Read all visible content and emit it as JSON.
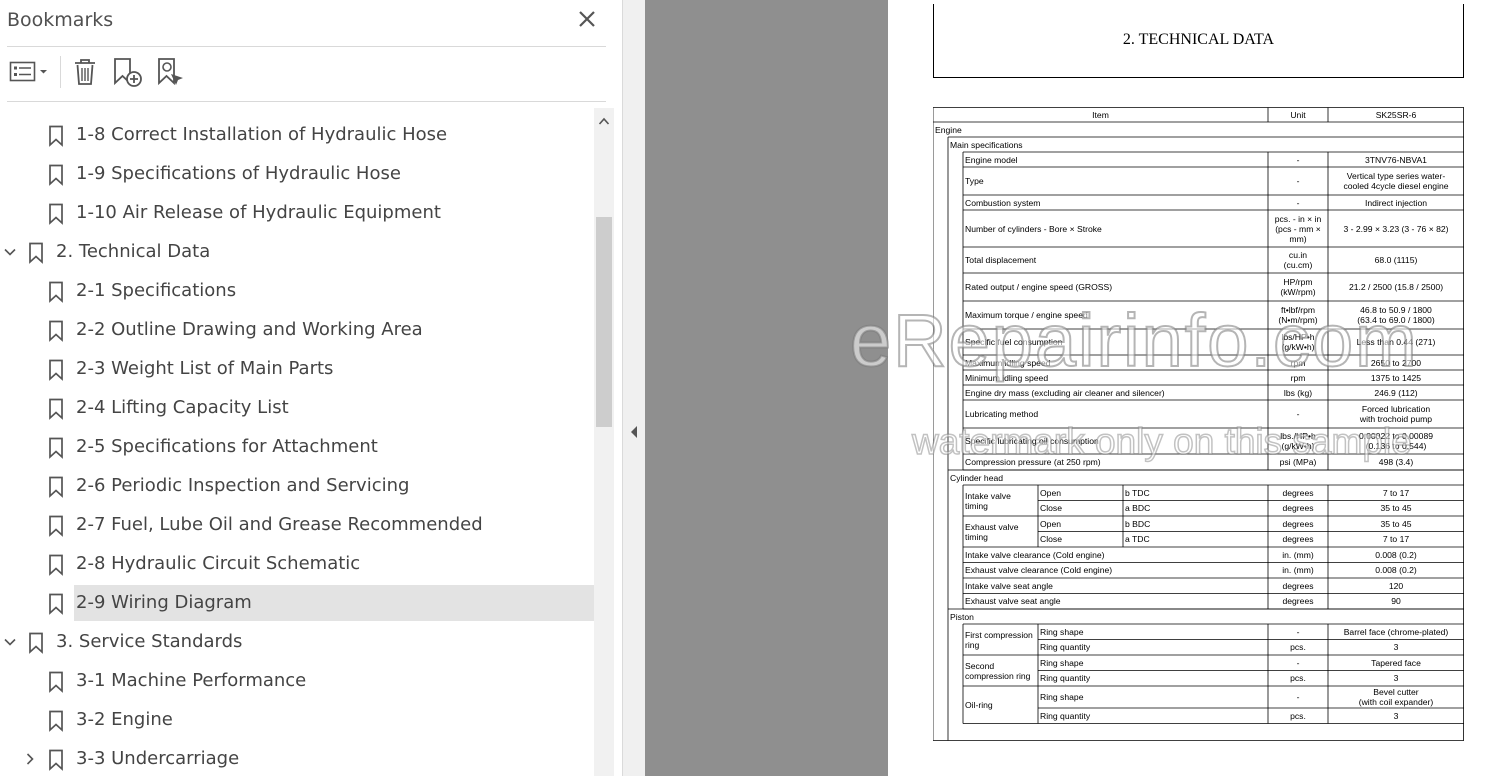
{
  "panel": {
    "title": "Bookmarks",
    "toolbar": {
      "options_icon": "list-options-icon",
      "delete_icon": "trash-icon",
      "new_bookmark_icon": "bookmark-add-icon",
      "find_bookmark_icon": "bookmark-search-icon"
    },
    "bookmarks": [
      {
        "label": "1-8 Correct Installation of Hydraulic Hose",
        "level": 2,
        "expander": "none",
        "selected": false
      },
      {
        "label": "1-9 Specifications of Hydraulic Hose",
        "level": 2,
        "expander": "none",
        "selected": false
      },
      {
        "label": "1-10 Air Release of Hydraulic Equipment",
        "level": 2,
        "expander": "none",
        "selected": false
      },
      {
        "label": "2. Technical Data",
        "level": 1,
        "expander": "expanded",
        "selected": false
      },
      {
        "label": "2-1 Specifications",
        "level": 2,
        "expander": "none",
        "selected": false
      },
      {
        "label": "2-2 Outline Drawing and Working Area",
        "level": 2,
        "expander": "none",
        "selected": false
      },
      {
        "label": "2-3 Weight List of Main Parts",
        "level": 2,
        "expander": "none",
        "selected": false
      },
      {
        "label": "2-4 Lifting Capacity List",
        "level": 2,
        "expander": "none",
        "selected": false
      },
      {
        "label": "2-5 Specifications for Attachment",
        "level": 2,
        "expander": "none",
        "selected": false
      },
      {
        "label": "2-6 Periodic Inspection and Servicing",
        "level": 2,
        "expander": "none",
        "selected": false
      },
      {
        "label": "2-7 Fuel, Lube Oil and Grease Recommended",
        "level": 2,
        "expander": "none",
        "selected": false
      },
      {
        "label": "2-8 Hydraulic Circuit Schematic",
        "level": 2,
        "expander": "none",
        "selected": false
      },
      {
        "label": "2-9 Wiring Diagram",
        "level": 2,
        "expander": "none",
        "selected": true
      },
      {
        "label": "3. Service Standards",
        "level": 1,
        "expander": "expanded",
        "selected": false
      },
      {
        "label": "3-1 Machine Performance",
        "level": 2,
        "expander": "none",
        "selected": false
      },
      {
        "label": "3-2 Engine",
        "level": 2,
        "expander": "none",
        "selected": false
      },
      {
        "label": "3-3 Undercarriage",
        "level": 2,
        "expander": "collapsed",
        "selected": false
      }
    ]
  },
  "document": {
    "title": "2. TECHNICAL DATA",
    "header": {
      "item": "Item",
      "unit": "Unit",
      "model": "SK25SR-6"
    },
    "sections": {
      "engine": "Engine",
      "main_spec": "Main specifications",
      "cyl_head": "Cylinder head",
      "piston": "Piston"
    },
    "main_rows": [
      {
        "item": "Engine model",
        "unit": "-",
        "value": "3TNV76-NBVA1"
      },
      {
        "item": "Type",
        "unit": "-",
        "value": "Vertical type series water-\ncooled 4cycle diesel engine"
      },
      {
        "item": "Combustion system",
        "unit": "-",
        "value": "Indirect injection"
      },
      {
        "item": "Number of cylinders - Bore × Stroke",
        "unit": "pcs. - in × in\n(pcs - mm ×\nmm)",
        "value": "3 - 2.99 × 3.23 (3 - 76 × 82)"
      },
      {
        "item": "Total displacement",
        "unit": "cu.in\n(cu.cm)",
        "value": "68.0 (1115)"
      },
      {
        "item": "Rated output / engine speed (GROSS)",
        "unit": "HP/rpm\n(kW/rpm)",
        "value": "21.2 / 2500 (15.8 / 2500)"
      },
      {
        "item": "Maximum torque / engine speed",
        "unit": "ft•lbf/rpm\n(N•m/rpm)",
        "value": "46.8 to 50.9 / 1800\n(63.4 to 69.0 / 1800)"
      },
      {
        "item": "Specific fuel consumption",
        "unit": "lbs/HP•h\n(g/kW•h)",
        "value": "Less than 0.44 (271)"
      },
      {
        "item": "Maximum idling speed",
        "unit": "rpm",
        "value": "2650 to 2700"
      },
      {
        "item": "Minimum idling speed",
        "unit": "rpm",
        "value": "1375 to 1425"
      },
      {
        "item": "Engine dry mass (excluding air cleaner and silencer)",
        "unit": "lbs (kg)",
        "value": "246.9 (112)"
      },
      {
        "item": "Lubricating method",
        "unit": "-",
        "value": "Forced lubrication\nwith trochoid pump"
      },
      {
        "item": "Specific lubricating oil consumption",
        "unit": "lbs./HP•h\n(g/kW•h)",
        "value": "0.00022 to 0.00089\n(0.136 to 0.544)"
      },
      {
        "item": "Compression pressure (at 250 rpm)",
        "unit": "psi (MPa)",
        "value": "498 (3.4)"
      }
    ],
    "valve_timing": [
      {
        "group": "Intake valve\ntiming",
        "rows": [
          {
            "state": "Open",
            "ref": "b TDC",
            "unit": "degrees",
            "value": "7 to 17"
          },
          {
            "state": "Close",
            "ref": "a BDC",
            "unit": "degrees",
            "value": "35 to 45"
          }
        ]
      },
      {
        "group": "Exhaust valve\ntiming",
        "rows": [
          {
            "state": "Open",
            "ref": "b BDC",
            "unit": "degrees",
            "value": "35 to 45"
          },
          {
            "state": "Close",
            "ref": "a TDC",
            "unit": "degrees",
            "value": "7 to 17"
          }
        ]
      }
    ],
    "head_rows": [
      {
        "item": "Intake valve clearance (Cold engine)",
        "unit": "in. (mm)",
        "value": "0.008 (0.2)"
      },
      {
        "item": "Exhaust valve clearance (Cold engine)",
        "unit": "in. (mm)",
        "value": "0.008 (0.2)"
      },
      {
        "item": "Intake valve seat angle",
        "unit": "degrees",
        "value": "120"
      },
      {
        "item": "Exhaust valve seat angle",
        "unit": "degrees",
        "value": "90"
      }
    ],
    "piston_rows": [
      {
        "group": "First compression\nring",
        "rows": [
          {
            "prop": "Ring shape",
            "unit": "-",
            "value": "Barrel face (chrome-plated)"
          },
          {
            "prop": "Ring quantity",
            "unit": "pcs.",
            "value": "3"
          }
        ]
      },
      {
        "group": "Second\ncompression ring",
        "rows": [
          {
            "prop": "Ring shape",
            "unit": "-",
            "value": "Tapered face"
          },
          {
            "prop": "Ring quantity",
            "unit": "pcs.",
            "value": "3"
          }
        ]
      },
      {
        "group": "Oil-ring",
        "rows": [
          {
            "prop": "Ring shape",
            "unit": "-",
            "value": "Bevel cutter\n(with coil expander)"
          },
          {
            "prop": "Ring quantity",
            "unit": "pcs.",
            "value": "3"
          }
        ]
      }
    ]
  },
  "watermark": {
    "main": "eRepairinfo.com",
    "sub": "watermark only on this sample"
  }
}
